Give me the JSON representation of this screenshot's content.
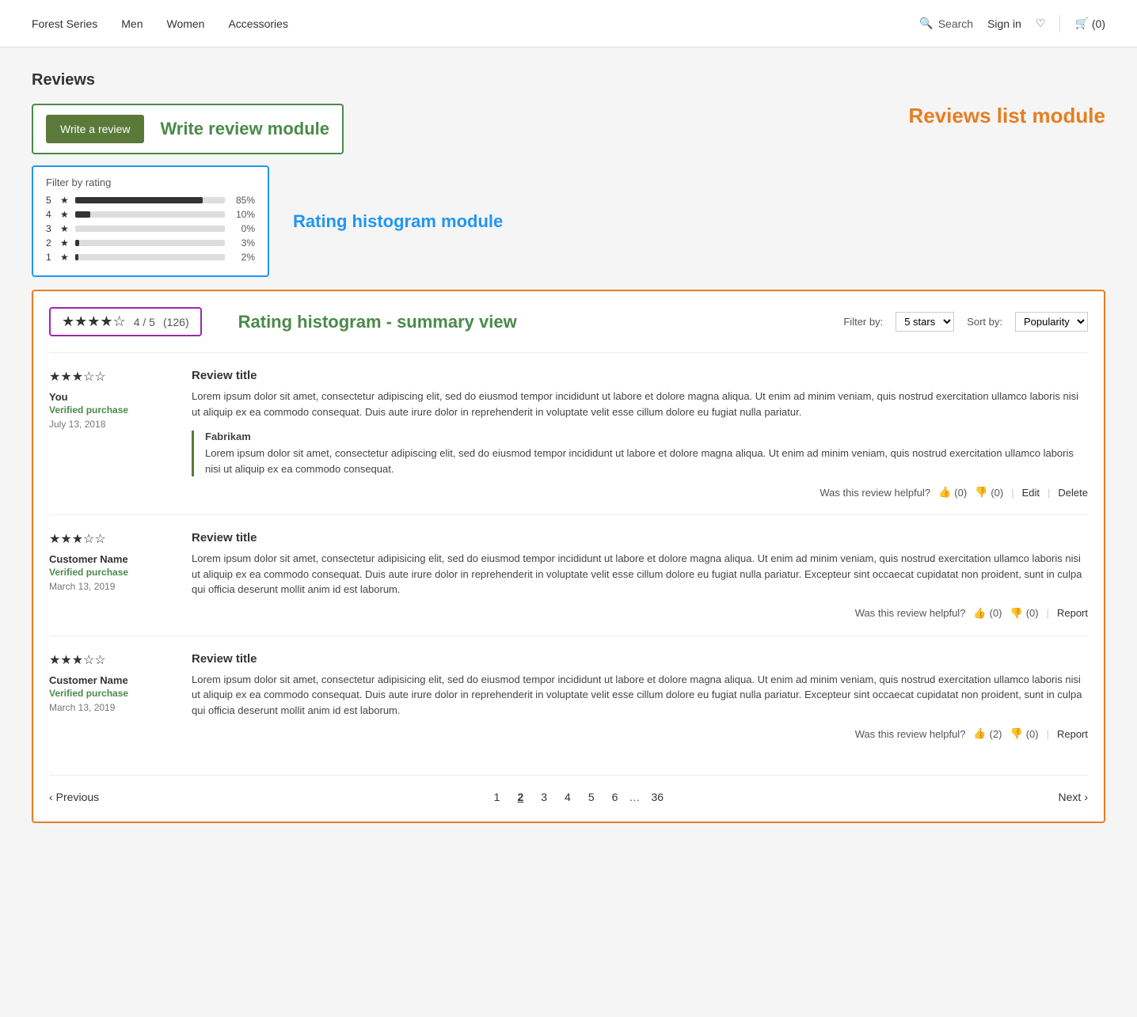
{
  "navbar": {
    "links": [
      "Forest Series",
      "Men",
      "Women",
      "Accessories"
    ],
    "search_label": "Search",
    "signin_label": "Sign in",
    "cart_label": "(0)"
  },
  "page": {
    "reviews_heading": "Reviews",
    "write_review_module_label": "Write review module",
    "write_review_btn": "Write a review",
    "rating_histogram_module_label": "Rating histogram module",
    "reviews_list_module_label": "Reviews list module",
    "histogram": {
      "title": "Filter by rating",
      "rows": [
        {
          "num": "5",
          "pct_num": "85%",
          "pct_val": 85
        },
        {
          "num": "4",
          "pct_num": "10%",
          "pct_val": 10
        },
        {
          "num": "3",
          "pct_num": "0%",
          "pct_val": 0
        },
        {
          "num": "2",
          "pct_num": "3%",
          "pct_val": 3
        },
        {
          "num": "1",
          "pct_num": "2%",
          "pct_val": 2
        }
      ]
    },
    "summary": {
      "stars": "★★★★☆",
      "score": "4 / 5",
      "count": "(126)",
      "histogram_label": "Rating histogram - summary view",
      "filter_label": "Filter by:",
      "filter_value": "5 stars",
      "sort_label": "Sort by:",
      "sort_value": "Popularity"
    },
    "reviews": [
      {
        "stars": "★★★☆☆",
        "user": "You",
        "verified": "Verified purchase",
        "date": "July 13, 2018",
        "title": "Review title",
        "body": "Lorem ipsum dolor sit amet, consectetur adipiscing elit, sed do eiusmod tempor incididunt ut labore et dolore magna aliqua. Ut enim ad minim veniam, quis nostrud exercitation ullamco laboris nisi ut aliquip ex ea commodo consequat. Duis aute irure dolor in reprehenderit in voluptate velit esse cillum dolore eu fugiat nulla pariatur.",
        "helpful_text": "Was this review helpful?",
        "thumbs_up": "(0)",
        "thumbs_down": "(0)",
        "actions": [
          "Edit",
          "Delete"
        ],
        "reply": {
          "name": "Fabrikam",
          "text": "Lorem ipsum dolor sit amet, consectetur adipiscing elit, sed do eiusmod tempor incididunt ut labore et dolore magna aliqua. Ut enim ad minim veniam, quis nostrud exercitation ullamco laboris nisi ut aliquip ex ea commodo consequat."
        }
      },
      {
        "stars": "★★★☆☆",
        "user": "Customer Name",
        "verified": "Verified purchase",
        "date": "March 13, 2019",
        "title": "Review title",
        "body": "Lorem ipsum dolor sit amet, consectetur adipisicing elit, sed do eiusmod tempor incididunt ut labore et dolore magna aliqua. Ut enim ad minim veniam, quis nostrud exercitation ullamco laboris nisi ut aliquip ex ea commodo consequat. Duis aute irure dolor in reprehenderit in voluptate velit esse cillum dolore eu fugiat nulla pariatur. Excepteur sint occaecat cupidatat non proident, sunt in culpa qui officia deserunt mollit anim id est laborum.",
        "helpful_text": "Was this review helpful?",
        "thumbs_up": "(0)",
        "thumbs_down": "(0)",
        "actions": [
          "Report"
        ],
        "reply": null
      },
      {
        "stars": "★★★☆☆",
        "user": "Customer Name",
        "verified": "Verified purchase",
        "date": "March 13, 2019",
        "title": "Review title",
        "body": "Lorem ipsum dolor sit amet, consectetur adipisicing elit, sed do eiusmod tempor incididunt ut labore et dolore magna aliqua. Ut enim ad minim veniam, quis nostrud exercitation ullamco laboris nisi ut aliquip ex ea commodo consequat. Duis aute irure dolor in reprehenderit in voluptate velit esse cillum dolore eu fugiat nulla pariatur. Excepteur sint occaecat cupidatat non proident, sunt in culpa qui officia deserunt mollit anim id est laborum.",
        "helpful_text": "Was this review helpful?",
        "thumbs_up": "(2)",
        "thumbs_down": "(0)",
        "actions": [
          "Report"
        ],
        "reply": null
      }
    ],
    "pagination": {
      "prev_label": "Previous",
      "next_label": "Next",
      "pages": [
        "1",
        "2",
        "3",
        "4",
        "5",
        "6",
        "...",
        "36"
      ],
      "current_page": "2"
    }
  }
}
